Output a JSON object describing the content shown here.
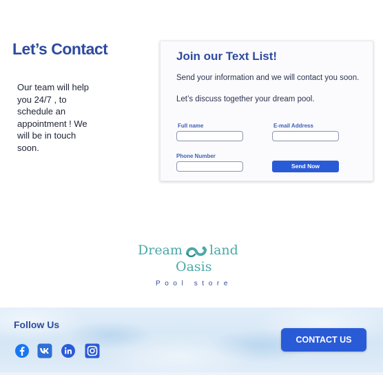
{
  "contact": {
    "heading": "Let’s Contact",
    "intro": "Our team will help you 24/7 , to schedule an appointment ! We will be in touch soon."
  },
  "form": {
    "title": "Join our Text List!",
    "line1": "Send your information and we will contact you soon.",
    "line2": "Let’s discuss together your dream pool.",
    "full_name_label": "Full name",
    "full_name_value": "",
    "email_label": "E-mail Address",
    "email_value": "",
    "phone_label": "Phone Number",
    "phone_value": "",
    "send_label": "Send Now"
  },
  "logo": {
    "line1_left": "Dream",
    "line1_right": "land",
    "line2": "Oasis",
    "tagline": "Pool store",
    "color": "#4aa8a8"
  },
  "footer": {
    "follow_label": "Follow Us",
    "social": [
      {
        "icon": "facebook-icon",
        "color": "#1877f2"
      },
      {
        "icon": "vk-icon",
        "color": "#2f6fd6"
      },
      {
        "icon": "linkedin-icon",
        "color": "#2a5bd7"
      },
      {
        "icon": "instagram-icon",
        "color": "#2a5bd7"
      }
    ],
    "contact_button": "CONTACT US"
  },
  "colors": {
    "accent": "#2a5bd7",
    "heading": "#2e4a9e"
  }
}
